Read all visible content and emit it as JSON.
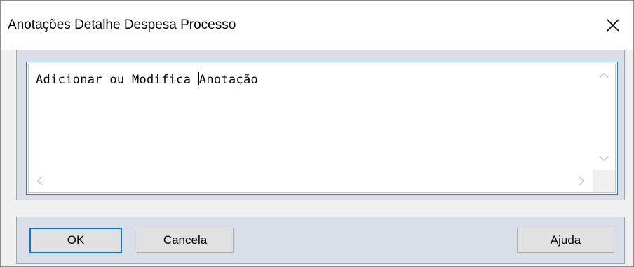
{
  "window": {
    "title": "Anotações Detalhe Despesa Processo"
  },
  "memo": {
    "text_before_caret": "Adicionar ou Modifica ",
    "text_after_caret": "Anotação"
  },
  "buttons": {
    "ok": "OK",
    "cancel": "Cancela",
    "help": "Ajuda"
  },
  "icons": {
    "close": "close-icon",
    "scroll_up": "chevron-up-icon",
    "scroll_down": "chevron-down-icon",
    "scroll_left": "chevron-left-icon",
    "scroll_right": "chevron-right-icon"
  }
}
